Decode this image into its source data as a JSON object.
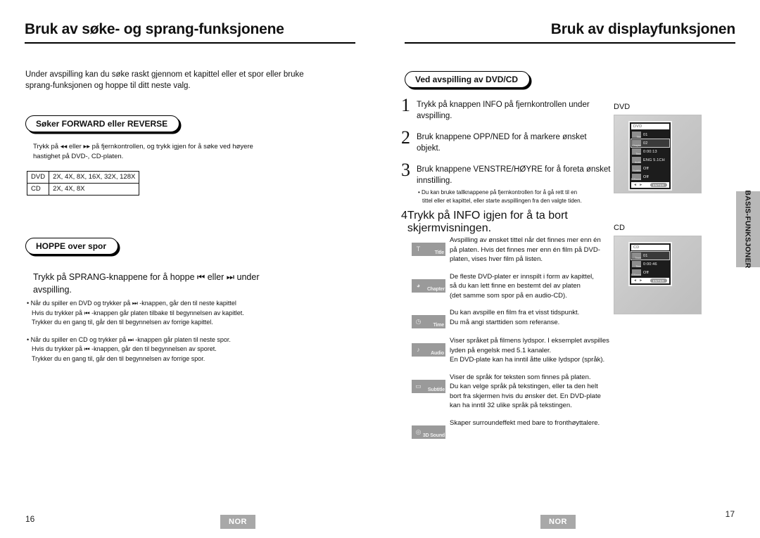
{
  "left_page": {
    "chapter_title": "Bruk av søke- og sprang-funksjonene",
    "intro": "Under avspilling kan du søke raskt gjennom et kapittel eller et spor eller bruke sprang-funksjonen og hoppe til ditt neste valg.",
    "section_forward": {
      "pill_label": "Søker FORWARD eller REVERSE",
      "paragraph": "Trykk på ◂◂ eller ▸▸ på fjernkontrollen, og trykk igjen for å søke ved høyere hastighet på DVD-, CD-platen.",
      "table": {
        "rows": [
          {
            "media": "DVD",
            "speeds": "2X, 4X, 8X, 16X, 32X, 128X"
          },
          {
            "media": "CD",
            "speeds": "2X, 4X, 8X"
          }
        ]
      }
    },
    "section_skip": {
      "pill_label": "HOPPE over spor",
      "paragraph": "Trykk på SPRANG-knappene for å hoppe ⏮  eller  ⏭  under avspilling.",
      "bullets": [
        {
          "line1": "• Når du spiller en DVD og trykker på ⏭ -knappen, går den til neste kapittel",
          "line2": "Hvis du trykker på ⏮ -knappen går platen tilbake til begynnelsen av kapitlet.",
          "line3": "Trykker du en gang til, går den til begynnelsen av forrige kapittel."
        },
        {
          "line1": "• Når du spiller en CD og trykker på ⏭ -knappen går platen til neste spor.",
          "line2": "Hvis du trykker på ⏮ -knappen, går den til begynnelsen av sporet.",
          "line3": "Trykker du en gang til, går den til begynnelsen av forrige spor."
        }
      ]
    },
    "page_number": "16",
    "language_badge": "NOR"
  },
  "right_page": {
    "chapter_title": "Bruk av displayfunksjonen",
    "section_pill": "Ved avspilling av DVD/CD",
    "steps": [
      {
        "number": "1",
        "text": "Trykk på knappen INFO på fjernkontrollen under avspilling."
      },
      {
        "number": "2",
        "text": "Bruk knappene OPP/NED for å markere ønsket objekt."
      },
      {
        "number": "3",
        "text": "Bruk knappene VENSTRE/HØYRE for å foreta ønsket innstilling.",
        "sub_line1": "• Du kan bruke tallknappene på fjernkontrollen for å gå rett til en",
        "sub_line2": "tittel eller et kapittel, eller starte avspillingen fra den valgte tiden."
      },
      {
        "number": "4",
        "text": "Trykk på INFO igjen for å ta bort skjermvisningen."
      }
    ],
    "icon_descriptions": [
      {
        "icon_name": "title-icon",
        "badge_label": "Title",
        "glyph": "T",
        "lines": [
          "Avspilling av ønsket tittel når det finnes mer enn én",
          "på platen. Hvis det finnes mer enn én film på DVD-",
          "platen, vises hver film på listen."
        ]
      },
      {
        "icon_name": "chapter-icon",
        "badge_label": "Chapter",
        "glyph": "◕",
        "lines": [
          "De fleste DVD-plater er innspilt i form av kapittel,",
          "så du kan lett finne en bestemt del av platen",
          "(det samme som spor på en audio-CD)."
        ]
      },
      {
        "icon_name": "time-icon",
        "badge_label": "Time",
        "glyph": "◷",
        "lines": [
          "Du kan avspille en film fra et visst tidspunkt.",
          "Du må angi starttiden som referanse."
        ]
      },
      {
        "icon_name": "audio-icon",
        "badge_label": "Audio",
        "glyph": "♪",
        "lines": [
          "Viser språket på filmens lydspor. I eksemplet avspilles",
          "lyden på engelsk med 5.1 kanaler.",
          "En DVD-plate kan ha inntil åtte ulike lydspor (språk)."
        ]
      },
      {
        "icon_name": "subtitle-icon",
        "badge_label": "Subtitle",
        "glyph": "▭",
        "lines": [
          "Viser de språk for teksten som finnes på platen.",
          "Du kan velge språk på tekstingen, eller ta den helt",
          "bort fra skjermen hvis du ønsker det. En DVD-plate",
          "kan ha inntil 32 ulike språk på tekstingen."
        ]
      },
      {
        "icon_name": "3d-sound-icon",
        "badge_label": "3D Sound",
        "glyph": "◎",
        "lines": [
          "Skaper surroundeffekt med bare to fronthøyttalere."
        ]
      }
    ],
    "osd_displays": [
      {
        "label": "DVD",
        "header": "DVD",
        "rows": [
          {
            "icon": "title-icon",
            "tag": "Title",
            "value": "01",
            "selected": false
          },
          {
            "icon": "chapter-icon",
            "tag": "Chapter",
            "value": "02",
            "selected": true
          },
          {
            "icon": "time-icon",
            "tag": "Time",
            "value": "0:00:13",
            "selected": false
          },
          {
            "icon": "audio-icon",
            "tag": "Audio",
            "value": "ENG 5.1CH",
            "selected": false
          },
          {
            "icon": "subtitle-icon",
            "tag": "Subtitle",
            "value": "Off",
            "selected": false
          },
          {
            "icon": "3d-sound-icon",
            "tag": "3DSound",
            "value": "Off",
            "selected": false
          }
        ],
        "foot_arrows": "◄ ►",
        "foot_enter": "ENTER"
      },
      {
        "label": "CD",
        "header": "CD",
        "rows": [
          {
            "icon": "track-icon",
            "tag": "Track",
            "value": "01",
            "selected": true
          },
          {
            "icon": "time-icon",
            "tag": "Time",
            "value": "0:00:46",
            "selected": false
          },
          {
            "icon": "3d-sound-icon",
            "tag": "3DSound",
            "value": "Off",
            "selected": false
          }
        ],
        "foot_arrows": "◄ ►",
        "foot_enter": "ENTER"
      }
    ],
    "side_tab": "BASIS-FUNKSJONER",
    "page_number": "17",
    "language_badge": "NOR"
  }
}
